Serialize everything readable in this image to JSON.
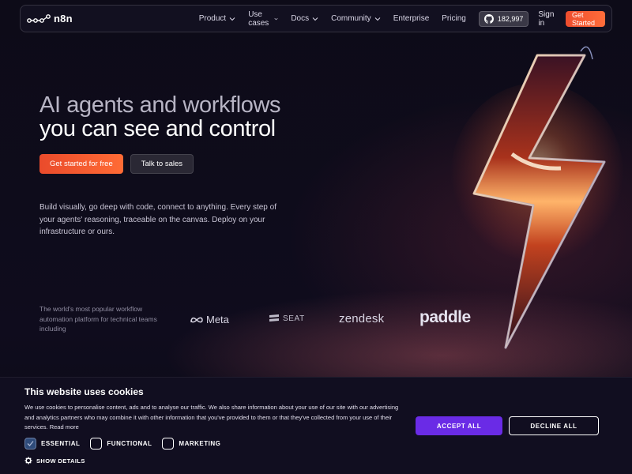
{
  "nav": {
    "logo_text": "n8n",
    "items": [
      {
        "label": "Product",
        "dropdown": true
      },
      {
        "label": "Use cases",
        "dropdown": true
      },
      {
        "label": "Docs",
        "dropdown": true
      },
      {
        "label": "Community",
        "dropdown": true
      },
      {
        "label": "Enterprise",
        "dropdown": false
      },
      {
        "label": "Pricing",
        "dropdown": false
      }
    ],
    "github_stars": "182,997",
    "signin_label": "Sign in",
    "get_started_label": "Get Started"
  },
  "hero": {
    "title_line1": "AI agents and workflows",
    "title_line2": "you can see and control",
    "primary_cta": "Get started for free",
    "secondary_cta": "Talk to sales",
    "description": "Build visually, go deep with code, connect to anything. Every step of your agents' reasoning, traceable on the canvas. Deploy on your infrastructure or ours."
  },
  "trust": {
    "text": "The world's most popular workflow automation platform for technical teams including",
    "logos": [
      "Meta",
      "SEAT",
      "zendesk",
      "paddle"
    ]
  },
  "cookie": {
    "title": "This website uses cookies",
    "text": "We use cookies to personalise content, ads and to analyse our traffic. We also share information about your use of our site with our advertising and analytics partners who may combine it with other information that you've provided to them or that they've collected from your use of their services.",
    "read_more": "Read more",
    "options": [
      {
        "label": "ESSENTIAL",
        "checked": true
      },
      {
        "label": "FUNCTIONAL",
        "checked": false
      },
      {
        "label": "MARKETING",
        "checked": false
      }
    ],
    "show_details": "SHOW DETAILS",
    "accept_label": "ACCEPT ALL",
    "decline_label": "DECLINE ALL"
  },
  "colors": {
    "accent_orange": "#ff6b35",
    "accept_purple": "#6a2be6",
    "background": "#0e0b1a"
  }
}
